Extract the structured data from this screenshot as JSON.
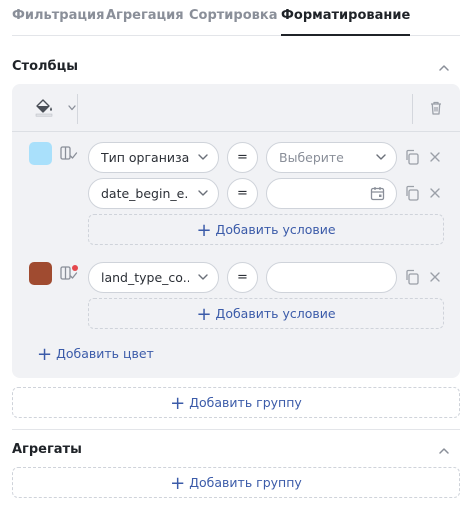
{
  "tabs": [
    {
      "label": "Фильтрация"
    },
    {
      "label": "Агрегация"
    },
    {
      "label": "Сортировка"
    },
    {
      "label": "Форматирование"
    }
  ],
  "active_tab": "Форматирование",
  "columns_section": {
    "title": "Столбцы",
    "groups": [
      {
        "color": "#a9e0fb",
        "conditions": [
          {
            "field": "Тип организа...",
            "operator": "=",
            "value_placeholder": "Выберите"
          },
          {
            "field": "date_begin_e...",
            "operator": "=",
            "value": ""
          }
        ],
        "add_condition_label": "Добавить условие"
      },
      {
        "color": "#a04b30",
        "conditions": [
          {
            "field": "land_type_co...",
            "operator": "=",
            "value": ""
          }
        ],
        "add_condition_label": "Добавить условие"
      }
    ],
    "add_color_label": "Добавить цвет",
    "add_group_label": "Добавить группу"
  },
  "aggregates_section": {
    "title": "Агрегаты",
    "add_group_label": "Добавить группу"
  },
  "colors": {
    "accent": "#3b5ba9",
    "panel_bg": "#f1f2f5",
    "badge_dot": "#e5484d"
  }
}
